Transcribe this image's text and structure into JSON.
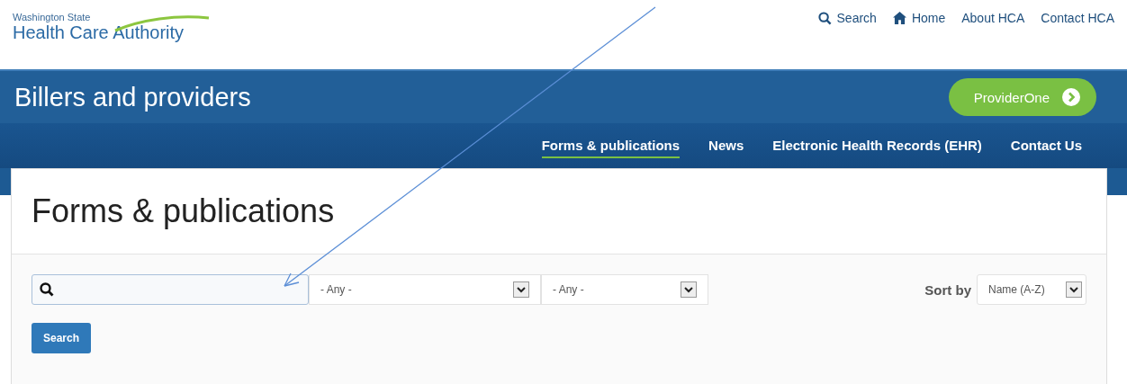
{
  "logo": {
    "line_1": "Washington State",
    "line_2": "Health Care Authority"
  },
  "utility_links": [
    {
      "label": "Search",
      "kind": "search"
    },
    {
      "label": "Home",
      "kind": "home"
    },
    {
      "label": "About HCA",
      "kind": "plain"
    },
    {
      "label": "Contact HCA",
      "kind": "plain"
    }
  ],
  "banner": {
    "title": "Billers and providers",
    "button": "ProviderOne"
  },
  "nav": [
    {
      "label": "Forms & publications",
      "selected": true
    },
    {
      "label": "News",
      "selected": false
    },
    {
      "label": "Electronic Health Records (EHR)",
      "selected": false
    },
    {
      "label": "Contact Us",
      "selected": false
    }
  ],
  "page_title": "Forms & publications",
  "filters": {
    "selects": [
      "- Any -",
      "- Any -"
    ],
    "button": "Search"
  },
  "sort": {
    "label": "Sort by",
    "value": "Name (A-Z)"
  }
}
